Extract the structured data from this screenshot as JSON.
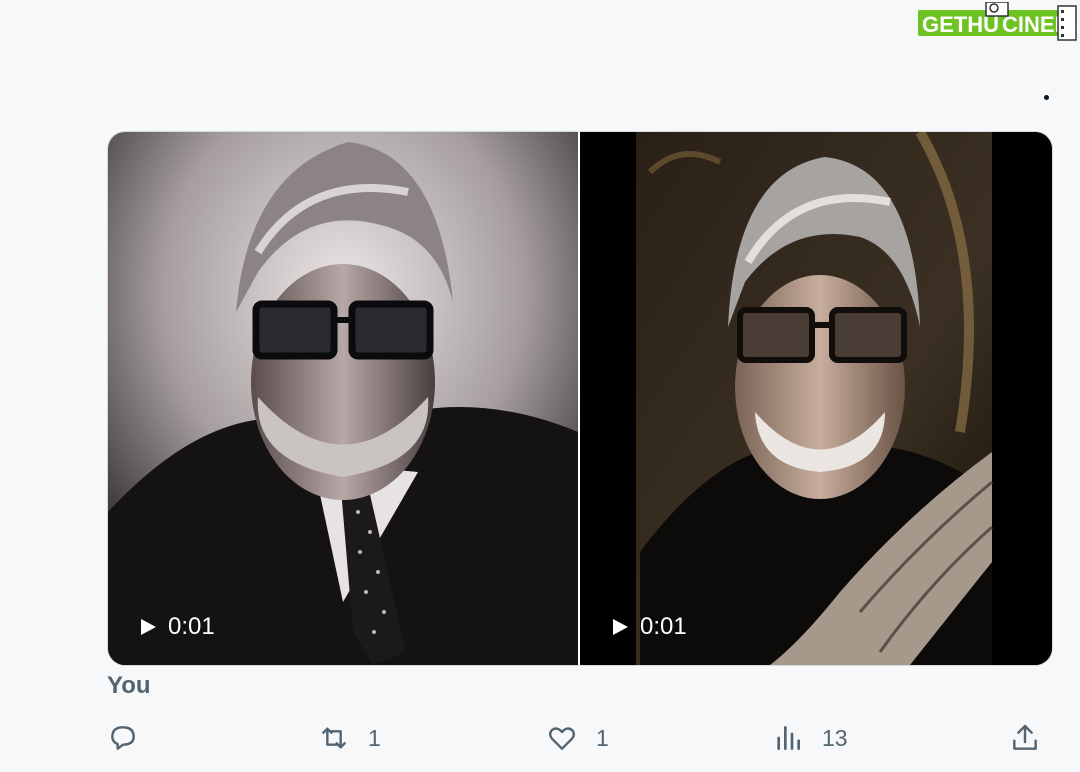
{
  "watermark": {
    "text_left": "GETHU",
    "text_right": "CINEMA"
  },
  "tweet": {
    "author": "You",
    "media": [
      {
        "duration": "0:01"
      },
      {
        "duration": "0:01"
      }
    ],
    "actions": {
      "reply_icon": "reply-icon",
      "retweet_count": "1",
      "like_count": "1",
      "views_count": "13",
      "share_icon": "share-icon"
    }
  },
  "colors": {
    "muted": "#536471",
    "background": "#f7f8f9",
    "watermark_green": "#6cc321"
  }
}
